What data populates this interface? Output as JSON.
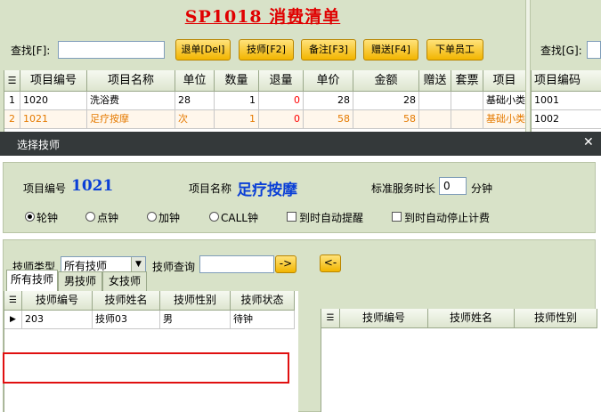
{
  "bg": {
    "title": "SP1018 消费清单",
    "search_label": "查找[F]:",
    "search_value": "",
    "buttons": {
      "refund": "退单[Del]",
      "tech": "技师[F2]",
      "remark": "备注[F3]",
      "gift": "赠送[F4]",
      "order_staff": "下单员工"
    },
    "right_search_label": "查找[G]:",
    "table": {
      "headers": [
        "项目编号",
        "项目名称",
        "单位",
        "数量",
        "退量",
        "单价",
        "金额",
        "赠送",
        "套票",
        "项目"
      ],
      "rows": [
        {
          "idx": "1",
          "code": "1020",
          "name": "洗浴费",
          "unit": "28",
          "qty": "1",
          "ret": "0",
          "price": "28",
          "amount": "28",
          "gift": "",
          "pkg": "",
          "extra": "基础小类"
        },
        {
          "idx": "2",
          "code": "1021",
          "name": "足疗按摩",
          "unit": "次",
          "qty": "1",
          "ret": "0",
          "price": "58",
          "amount": "58",
          "gift": "",
          "pkg": "",
          "extra": "基础小类"
        }
      ]
    },
    "right_table": {
      "header": "项目编码",
      "rows": [
        "1001",
        "1002"
      ]
    }
  },
  "dialog": {
    "title": "选择技师",
    "item_code_label": "项目编号",
    "item_code": "1021",
    "item_name_label": "项目名称",
    "item_name": "足疗按摩",
    "duration_label": "标准服务时长",
    "duration_value": "0",
    "duration_unit": "分钟",
    "radios": [
      {
        "label": "轮钟",
        "checked": true
      },
      {
        "label": "点钟",
        "checked": false
      },
      {
        "label": "加钟",
        "checked": false
      },
      {
        "label": "CALL钟",
        "checked": false
      }
    ],
    "checks": [
      {
        "label": "到时自动提醒",
        "checked": false
      },
      {
        "label": "到时自动停止计费",
        "checked": false
      }
    ],
    "tech_type_label": "技师类型",
    "tech_type_value": "所有技师",
    "tech_query_label": "技师查询",
    "tech_query_value": "",
    "go_right": "->",
    "go_left": "<-",
    "tabs": [
      "所有技师",
      "男技师",
      "女技师"
    ],
    "left_table": {
      "headers": [
        "技师编号",
        "技师姓名",
        "技师性别",
        "技师状态"
      ],
      "rows": [
        {
          "code": "203",
          "name": "技师03",
          "gender": "男",
          "status": "待钟"
        }
      ]
    },
    "right_table": {
      "headers": [
        "技师编号",
        "技师姓名",
        "技师性别"
      ]
    },
    "close_glyph": "✕",
    "colors": {
      "accent_blue": "#0a3fd6",
      "title_red": "#e00000",
      "button_yellow": "#f2b500",
      "highlight_red": "#e01010"
    }
  }
}
